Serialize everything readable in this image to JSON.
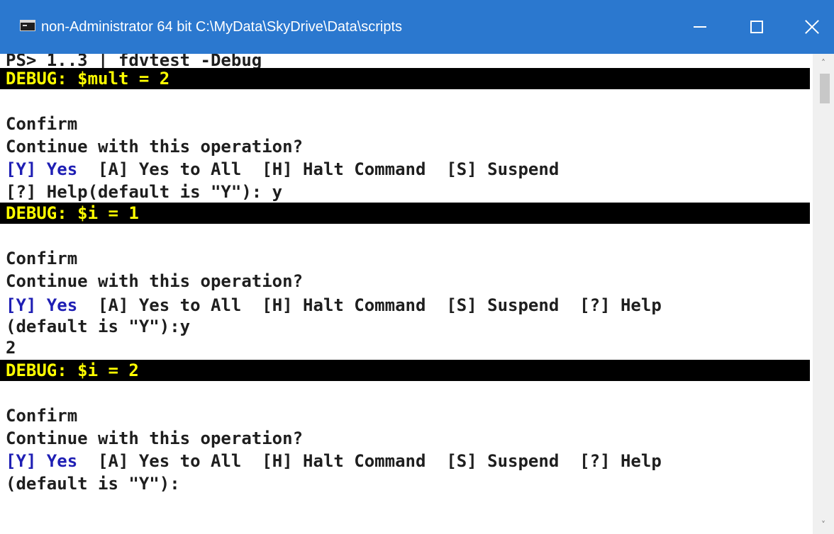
{
  "window": {
    "title": "non-Administrator 64 bit C:\\MyData\\SkyDrive\\Data\\scripts",
    "title_bar_color": "#2b78cf",
    "controls": [
      "minimize-icon",
      "maximize-icon",
      "close-icon"
    ]
  },
  "console": {
    "text_color": "#1e1e1e",
    "debug_fg": "#ffff00",
    "debug_bg": "#000000",
    "yes_color": "#1f1fb4",
    "command": "PS> 1..3 | fdvtest -Debug",
    "debug1": "DEBUG: $mult = 2",
    "block1": {
      "confirm": "Confirm",
      "question": "Continue with this operation?",
      "yes": "[Y] Yes",
      "options": "  [A] Yes to All  [H] Halt Command  [S] Suspend",
      "help": "[?] Help(default is \"Y\"): y"
    },
    "debug2": "DEBUG: $i = 1",
    "block2": {
      "confirm": "Confirm",
      "question": "Continue with this operation?",
      "yes": "[Y] Yes",
      "options": "  [A] Yes to All  [H] Halt Command  [S] Suspend  [?] Help",
      "default": "(default is \"Y\"):y",
      "output": "2"
    },
    "debug3": "DEBUG: $i = 2",
    "block3": {
      "confirm": "Confirm",
      "question": "Continue with this operation?",
      "yes": "[Y] Yes",
      "options": "  [A] Yes to All  [H] Halt Command  [S] Suspend  [?] Help",
      "default": "(default is \"Y\"):"
    }
  },
  "scrollbar": {
    "up_icon": "scroll-up-arrow-icon",
    "down_icon": "scroll-down-arrow-icon"
  }
}
